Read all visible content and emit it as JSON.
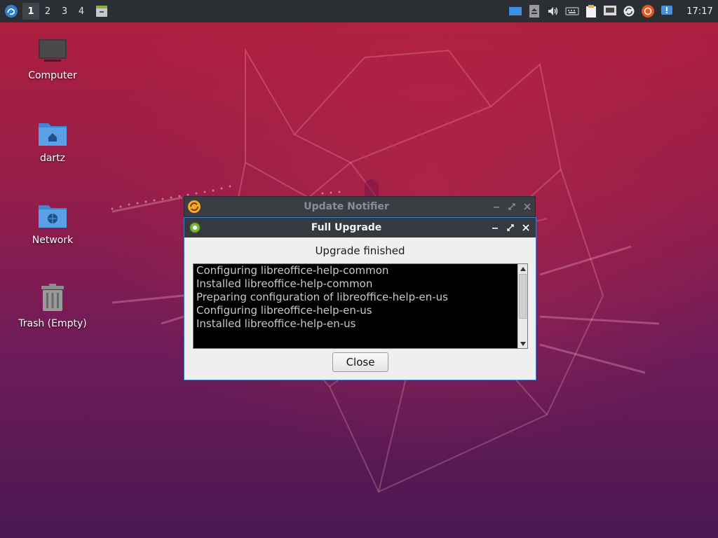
{
  "panel": {
    "workspaces": [
      "1",
      "2",
      "3",
      "4"
    ],
    "active_workspace": "1",
    "clock": "17:17",
    "tray_icons": [
      "display-icon",
      "eject-icon",
      "volume-icon",
      "keyboard-icon",
      "clipboard-icon",
      "network-icon",
      "update-icon",
      "ubuntu-icon",
      "notification-icon"
    ]
  },
  "desktop": {
    "icons": [
      {
        "label": "Computer",
        "icon": "computer-icon"
      },
      {
        "label": "dartz",
        "icon": "home-folder-icon"
      },
      {
        "label": "Network",
        "icon": "network-folder-icon"
      },
      {
        "label": "Trash (Empty)",
        "icon": "trash-icon"
      }
    ]
  },
  "back_window": {
    "title": "Update Notifier"
  },
  "dialog": {
    "title": "Full Upgrade",
    "heading": "Upgrade finished",
    "log_lines": [
      "Configuring libreoffice-help-common",
      "Installed libreoffice-help-common",
      "Preparing configuration of libreoffice-help-en-us",
      "Configuring libreoffice-help-en-us",
      "Installed libreoffice-help-en-us"
    ],
    "close_label": "Close"
  },
  "colors": {
    "panel_bg": "#2b2e33",
    "accent_border": "#3d7cc9",
    "titlebar_bg": "#353a40"
  }
}
